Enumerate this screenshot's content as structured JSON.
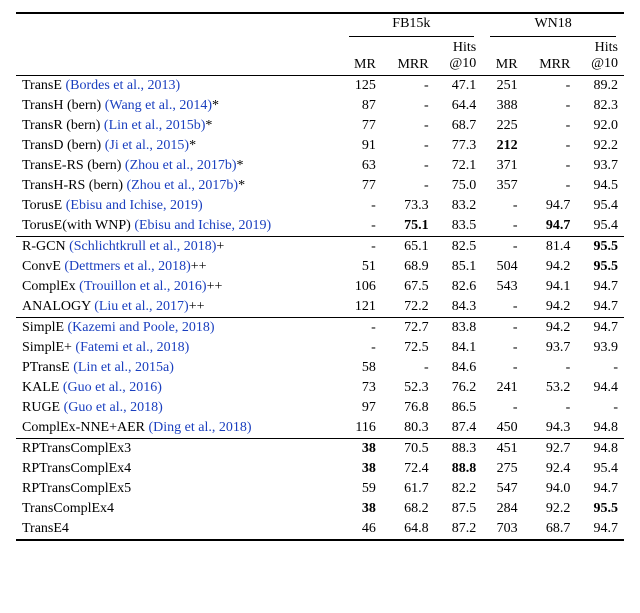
{
  "chart_data": {
    "type": "table",
    "title": "",
    "datasets": [
      "FB15k",
      "WN18"
    ],
    "columns_per_dataset": [
      "MR",
      "MRR",
      "Hits@10"
    ],
    "groups": [
      {
        "rows": [
          {
            "method_prefix": "TransE",
            "cite": "(Bordes et al., 2013)",
            "suffix": "",
            "fb": {
              "mr": "125",
              "mrr": "-",
              "hits": "47.1"
            },
            "wn": {
              "mr": "251",
              "mrr": "-",
              "hits": "89.2"
            }
          },
          {
            "method_prefix": "TransH (bern)",
            "cite": "(Wang et al., 2014)",
            "suffix": "*",
            "fb": {
              "mr": "87",
              "mrr": "-",
              "hits": "64.4"
            },
            "wn": {
              "mr": "388",
              "mrr": "-",
              "hits": "82.3"
            }
          },
          {
            "method_prefix": "TransR (bern)",
            "cite": "(Lin et al., 2015b)",
            "suffix": "*",
            "fb": {
              "mr": "77",
              "mrr": "-",
              "hits": "68.7"
            },
            "wn": {
              "mr": "225",
              "mrr": "-",
              "hits": "92.0"
            }
          },
          {
            "method_prefix": "TransD (bern)",
            "cite": "(Ji et al., 2015)",
            "suffix": "*",
            "fb": {
              "mr": "91",
              "mrr": "-",
              "hits": "77.3"
            },
            "wn": {
              "mr": "212",
              "mr_bold": true,
              "mrr": "-",
              "hits": "92.2"
            }
          },
          {
            "method_prefix": "TransE-RS (bern)",
            "cite": "(Zhou et al., 2017b)",
            "suffix": "*",
            "fb": {
              "mr": "63",
              "mrr": "-",
              "hits": "72.1"
            },
            "wn": {
              "mr": "371",
              "mrr": "-",
              "hits": "93.7"
            }
          },
          {
            "method_prefix": "TransH-RS (bern)",
            "cite": "(Zhou et al., 2017b)",
            "suffix": "*",
            "fb": {
              "mr": "77",
              "mrr": "-",
              "hits": "75.0"
            },
            "wn": {
              "mr": "357",
              "mrr": "-",
              "hits": "94.5"
            }
          },
          {
            "method_prefix": "TorusE",
            "cite": "(Ebisu and Ichise, 2019)",
            "suffix": "",
            "fb": {
              "mr": "-",
              "mrr": "73.3",
              "hits": "83.2"
            },
            "wn": {
              "mr": "-",
              "mrr": "94.7",
              "hits": "95.4"
            }
          },
          {
            "method_prefix": "TorusE(with WNP)",
            "cite": "(Ebisu and Ichise, 2019)",
            "suffix": "",
            "fb": {
              "mr": "-",
              "mrr": "75.1",
              "mrr_bold": true,
              "hits": "83.5"
            },
            "wn": {
              "mr": "-",
              "mrr": "94.7",
              "mrr_bold": true,
              "hits": "95.4"
            }
          }
        ]
      },
      {
        "rows": [
          {
            "method_prefix": "R-GCN",
            "cite": "(Schlichtkrull et al., 2018)",
            "suffix": "+",
            "fb": {
              "mr": "-",
              "mrr": "65.1",
              "hits": "82.5"
            },
            "wn": {
              "mr": "-",
              "mrr": "81.4",
              "hits": "95.5",
              "hits_bold": true
            }
          },
          {
            "method_prefix": "ConvE",
            "cite": "(Dettmers et al., 2018)",
            "suffix": "++",
            "fb": {
              "mr": "51",
              "mrr": "68.9",
              "hits": "85.1"
            },
            "wn": {
              "mr": "504",
              "mrr": "94.2",
              "hits": "95.5",
              "hits_bold": true
            }
          },
          {
            "method_prefix": "ComplEx",
            "cite": "(Trouillon et al., 2016)",
            "suffix": "++",
            "fb": {
              "mr": "106",
              "mrr": "67.5",
              "hits": "82.6"
            },
            "wn": {
              "mr": "543",
              "mrr": "94.1",
              "hits": "94.7"
            }
          },
          {
            "method_prefix": "ANALOGY",
            "cite": "(Liu et al., 2017)",
            "suffix": "++",
            "fb": {
              "mr": "121",
              "mrr": "72.2",
              "hits": "84.3"
            },
            "wn": {
              "mr": "-",
              "mrr": "94.2",
              "hits": "94.7"
            }
          }
        ]
      },
      {
        "rows": [
          {
            "method_prefix": "SimplE",
            "cite": "(Kazemi and Poole, 2018)",
            "suffix": "",
            "fb": {
              "mr": "-",
              "mrr": "72.7",
              "hits": "83.8"
            },
            "wn": {
              "mr": "-",
              "mrr": "94.2",
              "hits": "94.7"
            }
          },
          {
            "method_prefix": "SimplE+",
            "cite": "(Fatemi et al., 2018)",
            "suffix": "",
            "fb": {
              "mr": "-",
              "mrr": "72.5",
              "hits": "84.1"
            },
            "wn": {
              "mr": "-",
              "mrr": "93.7",
              "hits": "93.9"
            }
          },
          {
            "method_prefix": "PTransE",
            "cite": "(Lin et al., 2015a)",
            "suffix": "",
            "fb": {
              "mr": "58",
              "mrr": "-",
              "hits": "84.6"
            },
            "wn": {
              "mr": "-",
              "mrr": "-",
              "hits": "-"
            }
          },
          {
            "method_prefix": "KALE",
            "cite": "(Guo et al., 2016)",
            "suffix": "",
            "fb": {
              "mr": "73",
              "mrr": "52.3",
              "hits": "76.2"
            },
            "wn": {
              "mr": "241",
              "mrr": "53.2",
              "hits": "94.4"
            }
          },
          {
            "method_prefix": "RUGE",
            "cite": "(Guo et al., 2018)",
            "suffix": "",
            "fb": {
              "mr": "97",
              "mrr": "76.8",
              "hits": "86.5"
            },
            "wn": {
              "mr": "-",
              "mrr": "-",
              "hits": "-"
            }
          },
          {
            "method_prefix": "ComplEx-NNE+AER",
            "cite": "(Ding et al., 2018)",
            "suffix": "",
            "fb": {
              "mr": "116",
              "mrr": "80.3",
              "hits": "87.4"
            },
            "wn": {
              "mr": "450",
              "mrr": "94.3",
              "hits": "94.8"
            }
          }
        ]
      },
      {
        "rows": [
          {
            "method_prefix": "RPTransComplEx3",
            "cite": "",
            "suffix": "",
            "fb": {
              "mr": "38",
              "mr_bold": true,
              "mrr": "70.5",
              "hits": "88.3"
            },
            "wn": {
              "mr": "451",
              "mrr": "92.7",
              "hits": "94.8"
            }
          },
          {
            "method_prefix": "RPTransComplEx4",
            "cite": "",
            "suffix": "",
            "fb": {
              "mr": "38",
              "mr_bold": true,
              "mrr": "72.4",
              "hits": "88.8",
              "hits_bold": true
            },
            "wn": {
              "mr": "275",
              "mrr": "92.4",
              "hits": "95.4"
            }
          },
          {
            "method_prefix": "RPTransComplEx5",
            "cite": "",
            "suffix": "",
            "fb": {
              "mr": "59",
              "mrr": "61.7",
              "hits": "82.2"
            },
            "wn": {
              "mr": "547",
              "mrr": "94.0",
              "hits": "94.7"
            }
          },
          {
            "method_prefix": "TransComplEx4",
            "cite": "",
            "suffix": "",
            "fb": {
              "mr": "38",
              "mr_bold": true,
              "mrr": "68.2",
              "hits": "87.5"
            },
            "wn": {
              "mr": "284",
              "mrr": "92.2",
              "hits": "95.5",
              "hits_bold": true
            }
          },
          {
            "method_prefix": "TransE4",
            "cite": "",
            "suffix": "",
            "fb": {
              "mr": "46",
              "mrr": "64.8",
              "hits": "87.2"
            },
            "wn": {
              "mr": "703",
              "mrr": "68.7",
              "hits": "94.7"
            }
          }
        ]
      }
    ]
  },
  "header": {
    "fb": "FB15k",
    "wn": "WN18",
    "mr": "MR",
    "mrr": "MRR",
    "hits_line1": "Hits",
    "hits_line2": "@10"
  }
}
